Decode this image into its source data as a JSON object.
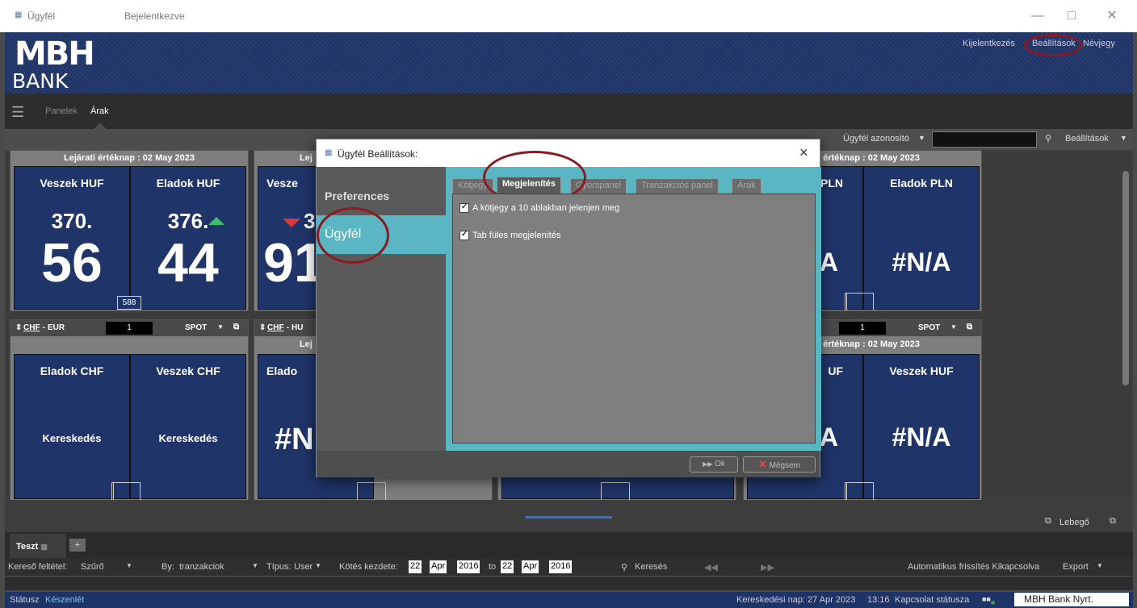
{
  "window": {
    "title": "Ügyfél",
    "status": "Bejelentkezve"
  },
  "banner": {
    "logo_top": "MBH",
    "logo_bottom": "BANK",
    "links": [
      "Kijelentkezés",
      "Beállítások",
      "Névjegy"
    ]
  },
  "menu": {
    "items": [
      "Panelek",
      "Árak"
    ]
  },
  "customer_bar": {
    "id_label": "Ügyfél azonosító",
    "settings_label": "Beállítások"
  },
  "panels": [
    {
      "header": "Lejárati értéknap : 02 May 2023",
      "tiles": [
        {
          "label": "Veszek HUF",
          "price_small": "370.",
          "price_big": "56"
        },
        {
          "label": "Eladok HUF",
          "price_small": "376.",
          "price_big": "44"
        }
      ],
      "spread": "588"
    },
    {
      "header": "Lej",
      "tiles": [
        {
          "label": "Vesze",
          "price_small": "3",
          "price_big": "91"
        }
      ]
    },
    {
      "header": "i értéknap : 02 May 2023",
      "tiles": [
        {
          "label": "PLN",
          "value": "A"
        },
        {
          "label": "Eladok PLN",
          "value": "#N/A"
        }
      ]
    },
    {
      "pair_base": "CHF",
      "pair_sep": " - ",
      "pair_quote": "EUR",
      "amount": "1",
      "type": "SPOT",
      "tiles": [
        {
          "label": "Eladok CHF",
          "value": "Kereskedés"
        },
        {
          "label": "Veszek CHF",
          "value": "Kereskedés"
        }
      ]
    },
    {
      "pair_base": "CHF",
      "pair_sep": " - ",
      "pair_quote": "HU",
      "header": "Lej",
      "tiles": [
        {
          "label": "Elado",
          "value": "#N"
        }
      ]
    },
    {
      "amount": "1",
      "type": "SPOT",
      "header": "i értéknap : 02 May 2023",
      "tiles": [
        {
          "label": "UF",
          "value": "A"
        },
        {
          "label": "Veszek HUF",
          "value": "#N/A"
        }
      ]
    }
  ],
  "bottom": {
    "tab": "Teszt",
    "add": "+",
    "floating": "Lebegő"
  },
  "filter": {
    "filter_label": "Kereső feltétel:",
    "filter_value": "Szűrő",
    "by_label": "By:",
    "by_value": "tranzakciok",
    "type_label": "Típus:",
    "type_value": "User",
    "date_label": "Kötés kezdete:",
    "from": {
      "day": "22",
      "month": "Apr",
      "year": "2016"
    },
    "to_label": "to",
    "to": {
      "day": "22",
      "month": "Apr",
      "year": "2016"
    },
    "search": "Keresés",
    "auto_refresh": "Automatikus frissítés Kikapcsolva",
    "export": "Export"
  },
  "status": {
    "label": "Státusz",
    "value": "Készenlét",
    "trading_day": "Kereskedési nap: 27 Apr 2023",
    "time": "13:16",
    "connection": "Kapcsolat státusza",
    "company": "MBH Bank Nyrt."
  },
  "dialog": {
    "title": "Ügyfél Beállítások:",
    "close": "×",
    "nav": [
      "Preferences",
      "Ügyfél"
    ],
    "tabs": [
      "Kötjegy",
      "Megjelenítés",
      "Gyorspanel",
      "Tranzakciós panel",
      "Árak"
    ],
    "options": [
      "A kötjegy a 10 ablakban jelenjen meg",
      "Tab füles megjelenítés"
    ],
    "ok": "Ok",
    "cancel": "Mégsem"
  },
  "colors": {
    "bank_blue": "#1e3366",
    "tile_blue": "#1f3468",
    "accent_teal": "#5ab6c2",
    "highlight_red": "#8b1a22"
  }
}
